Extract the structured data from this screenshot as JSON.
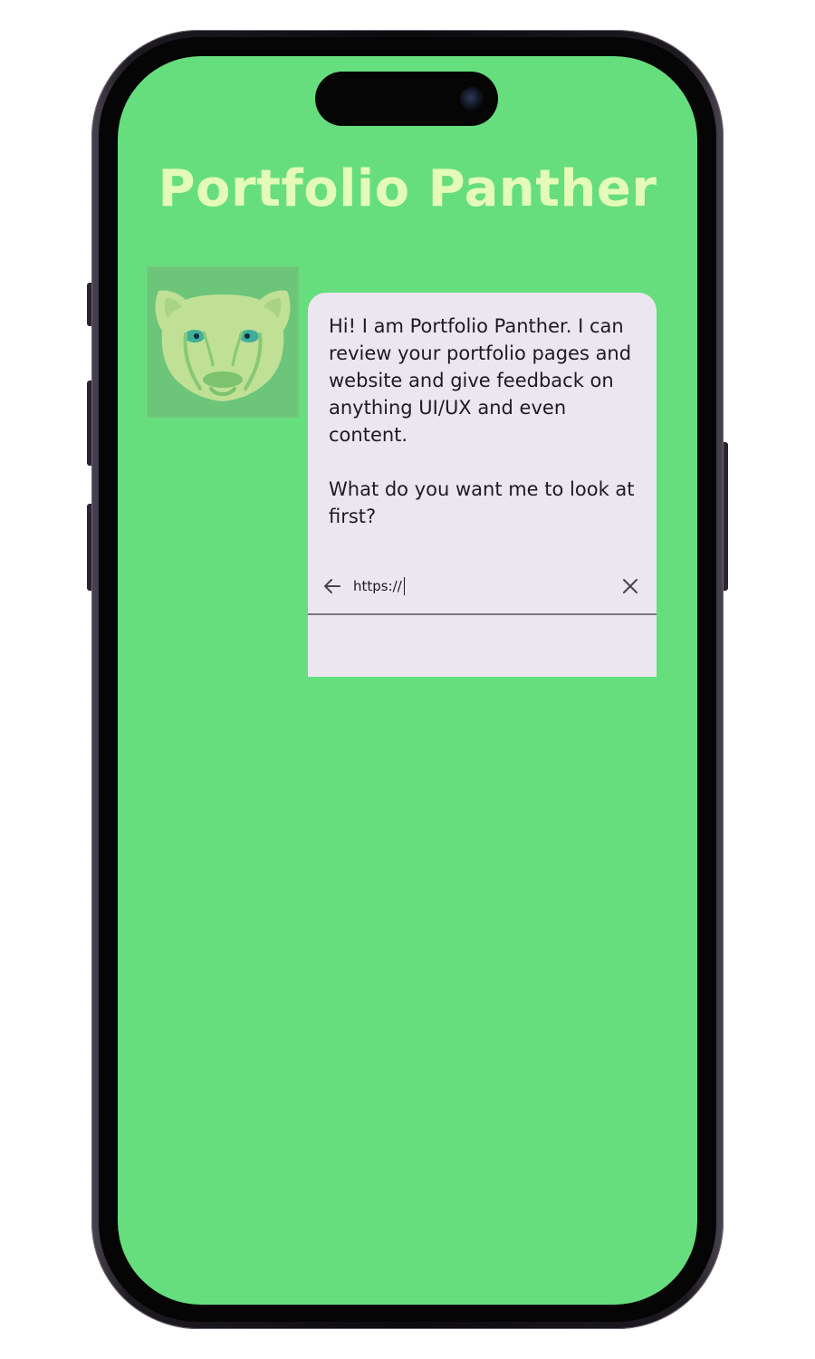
{
  "app": {
    "title": "Portfolio Panther"
  },
  "avatar": {
    "icon": "panther-icon"
  },
  "chat": {
    "message": "Hi! I am Portfolio Panther. I can review your portfolio pages and website and give feedback on anything UI/UX and even content.\n\nWhat do you want me to look at first?"
  },
  "url_bar": {
    "value": "https://",
    "back_icon": "arrow-left-icon",
    "close_icon": "close-icon"
  },
  "colors": {
    "screen_background": "#66de7d",
    "title_color": "#e4fbb8",
    "bubble_background": "#ebe6f0",
    "avatar_background": "#6cc579",
    "panther_color": "#bfe095"
  }
}
